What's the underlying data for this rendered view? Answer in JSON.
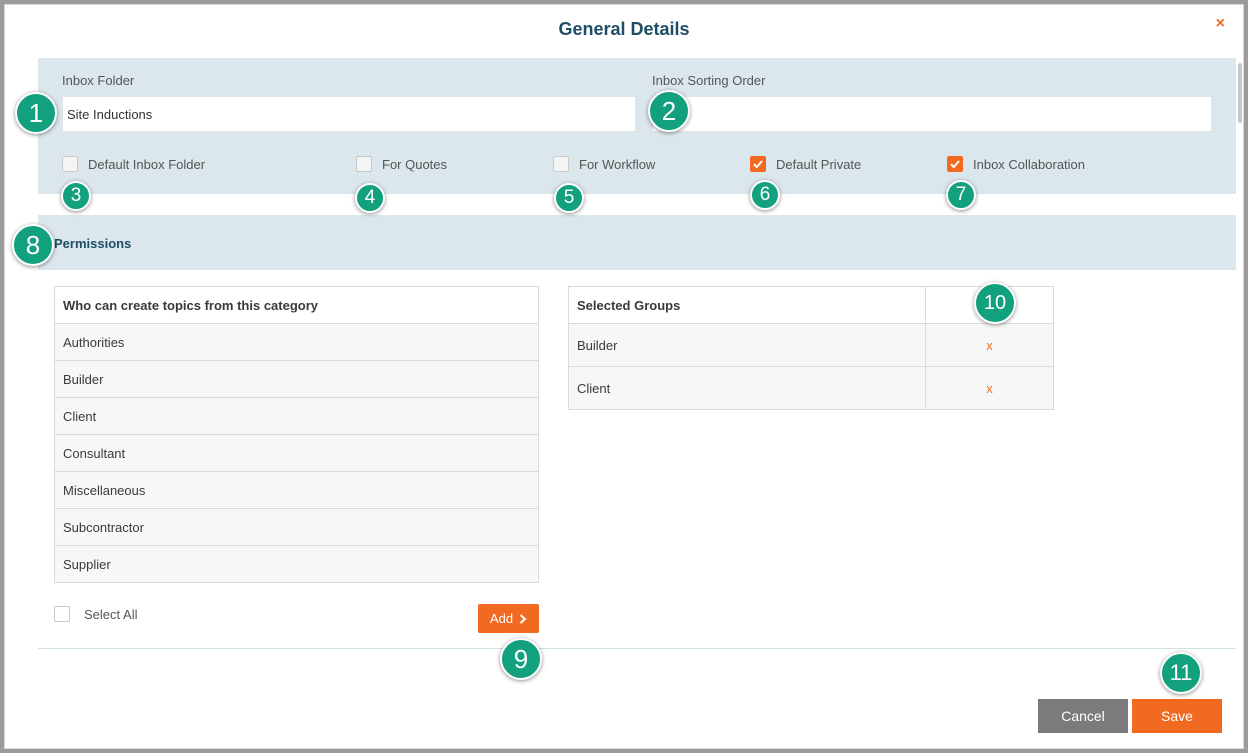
{
  "dialog": {
    "title": "General Details",
    "close_glyph": "×"
  },
  "details": {
    "inbox_folder_label": "Inbox Folder",
    "inbox_folder_value": "Site Inductions",
    "inbox_sorting_order_label": "Inbox Sorting Order",
    "inbox_sorting_order_value": "",
    "checkboxes": [
      {
        "label": "Default Inbox Folder",
        "checked": false
      },
      {
        "label": "For Quotes",
        "checked": false
      },
      {
        "label": "For Workflow",
        "checked": false
      },
      {
        "label": "Default Private",
        "checked": true
      },
      {
        "label": "Inbox Collaboration",
        "checked": true
      }
    ]
  },
  "permissions": {
    "title": "Permissions",
    "available_header": "Who can create topics from this category",
    "available_groups": [
      "Authorities",
      "Builder",
      "Client",
      "Consultant",
      "Miscellaneous",
      "Subcontractor",
      "Supplier"
    ],
    "selected_header": "Selected Groups",
    "selected_groups": [
      "Builder",
      "Client"
    ],
    "remove_glyph": "x",
    "select_all_label": "Select All",
    "add_label": "Add"
  },
  "footer": {
    "cancel_label": "Cancel",
    "save_label": "Save"
  },
  "callouts": [
    "1",
    "2",
    "3",
    "4",
    "5",
    "6",
    "7",
    "8",
    "9",
    "10",
    "11"
  ],
  "colors": {
    "accent": "#f26a21",
    "panel": "#dbe7ec",
    "title": "#1e4e66",
    "callout": "#13a07f",
    "cancel": "#7b7b7b"
  }
}
